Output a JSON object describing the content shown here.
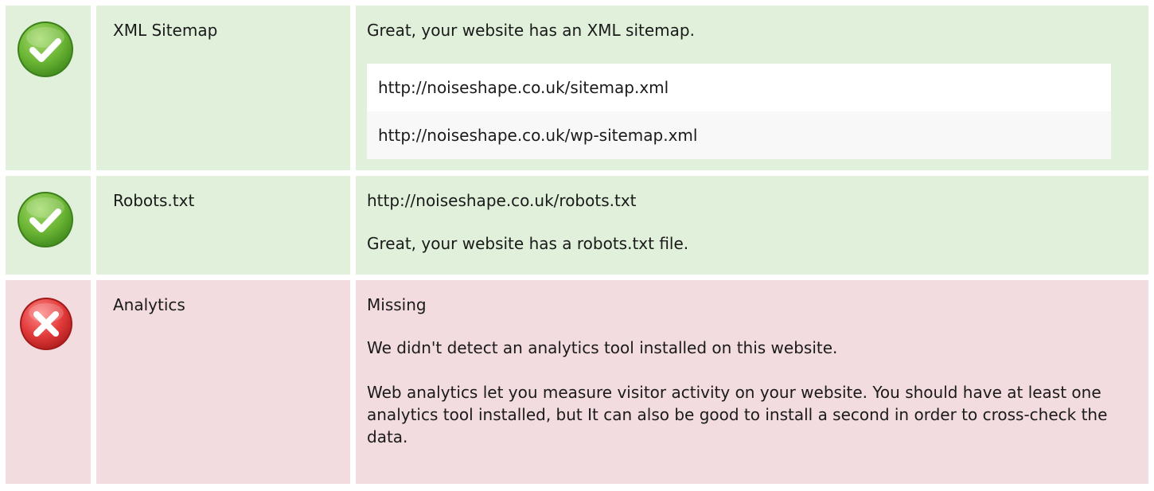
{
  "rows": [
    {
      "status": "pass",
      "icon": "check-icon",
      "name": "XML Sitemap",
      "message": "Great, your website has an XML sitemap.",
      "urls": [
        "http://noiseshape.co.uk/sitemap.xml",
        "http://noiseshape.co.uk/wp-sitemap.xml"
      ]
    },
    {
      "status": "pass",
      "icon": "check-icon",
      "name": "Robots.txt",
      "url": "http://noiseshape.co.uk/robots.txt",
      "message": "Great, your website has a robots.txt file."
    },
    {
      "status": "fail",
      "icon": "cross-icon",
      "name": "Analytics",
      "value": "Missing",
      "message": "We didn't detect an analytics tool installed on this website.",
      "advice": "Web analytics let you measure visitor activity on your website. You should have at least one analytics tool installed, but It can also be good to install a second in order to cross-check the data."
    }
  ],
  "colors": {
    "pass_bg": "#e0f0da",
    "fail_bg": "#f2dcdf",
    "pass_icon": "#6db33f",
    "fail_icon": "#e03a3a"
  }
}
